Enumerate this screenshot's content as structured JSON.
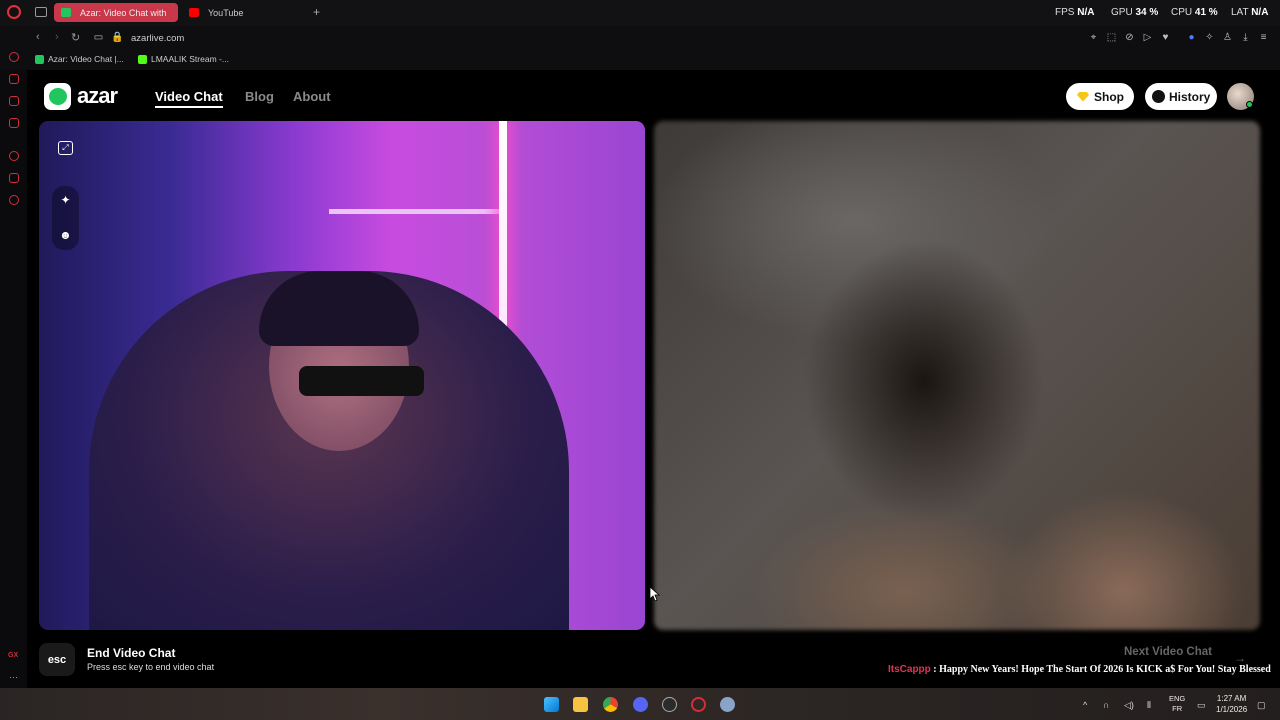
{
  "browser": {
    "tabs": [
      {
        "label": "Azar: Video Chat with",
        "active": true,
        "favicon_color": "#22c55e"
      },
      {
        "label": "YouTube",
        "active": false,
        "favicon_color": "#ff0000"
      }
    ],
    "new_tab_symbol": "+",
    "stats": {
      "fps_label": "FPS",
      "fps_value": "N/A",
      "gpu_label": "GPU",
      "gpu_value": "34 %",
      "cpu_label": "CPU",
      "cpu_value": "41 %",
      "lat_label": "LAT",
      "lat_value": "N/A"
    },
    "url": "azarlive.com",
    "bookmarks": [
      {
        "label": "Azar: Video Chat |...",
        "icon_color": "#22c55e"
      },
      {
        "label": "LMAALIK Stream -...",
        "icon_color": "#53fc18"
      }
    ],
    "sidebar_bottom_label": "GX",
    "accent_color": "#c8384a"
  },
  "site": {
    "brand": "azar",
    "nav": [
      {
        "label": "Video Chat",
        "active": true
      },
      {
        "label": "Blog",
        "active": false
      },
      {
        "label": "About",
        "active": false
      }
    ],
    "shop_label": "Shop",
    "history_label": "History"
  },
  "video_tools": {
    "expand_icon": "expand-icon",
    "effects_icon": "sparkle-icon",
    "face_icon": "face-filter-icon"
  },
  "controls": {
    "esc_key": "esc",
    "end_title": "End Video Chat",
    "end_subtitle": "Press esc key to end video chat",
    "next_label": "Next Video Chat",
    "next_arrow": "→"
  },
  "chat_overlay": {
    "username": "ItsCappp",
    "separator": " : ",
    "message": "Happy New Years! Hope The Start Of 2026 Is KICK a$ For You! Stay Blessed"
  },
  "taskbar": {
    "apps": [
      "windows-start-icon",
      "file-explorer-icon",
      "chrome-icon",
      "discord-icon",
      "obs-icon",
      "opera-gx-icon",
      "settings-icon"
    ],
    "lang_top": "ENG",
    "lang_bottom": "FR",
    "time": "1:27 AM",
    "date": "1/1/2026"
  }
}
